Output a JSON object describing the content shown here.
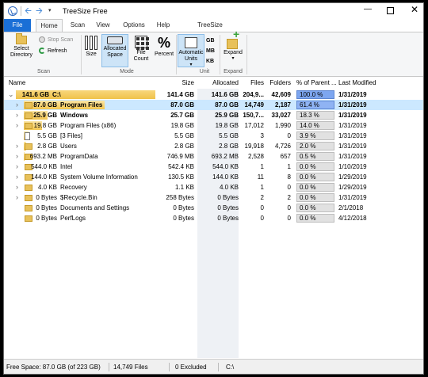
{
  "window": {
    "title": "TreeSize Free",
    "controls": {
      "minimize": "—",
      "close": "✕"
    },
    "nav": {
      "back": "🡨",
      "forward": "🡪",
      "dropdown": "▾"
    }
  },
  "tabs": [
    "File",
    "Home",
    "Scan",
    "View",
    "Options",
    "Help",
    "TreeSize Professional"
  ],
  "ribbon": {
    "scan_group": {
      "select_directory": "Select\nDirectory",
      "stop_scan": "Stop Scan",
      "refresh": "Refresh",
      "label": "Scan"
    },
    "mode_group": {
      "size": "Size",
      "allocated_space": "Allocated\nSpace",
      "file_count": "File\nCount",
      "percent": "Percent",
      "label": "Mode"
    },
    "unit_group": {
      "gb": "GB",
      "mb": "MB",
      "kb": "KB",
      "automatic_units": "Automatic\nUnits",
      "label": "Unit"
    },
    "expand_group": {
      "expand": "Expand",
      "label": "Expand"
    },
    "icons": {
      "percent_glyph": "%",
      "dropdown": "▾"
    }
  },
  "columns": {
    "name": "Name",
    "size": "Size",
    "allocated": "Allocated",
    "files": "Files",
    "folders": "Folders",
    "pct_parent": "% of Parent ...",
    "last_modified": "Last Modified"
  },
  "rows": [
    {
      "gbsize": "141.6 GB",
      "name": "C:\\",
      "size": "141.4 GB",
      "allocated": "141.6 GB",
      "files": "204,9...",
      "folders": "42,609",
      "pct": "100.0 %",
      "pct_value": 100.0,
      "modified": "1/31/2019",
      "bold": true,
      "chevron": "⌄"
    },
    {
      "gbsize": "87.0 GB",
      "name": "Program Files",
      "size": "87.0 GB",
      "allocated": "87.0 GB",
      "files": "14,749",
      "folders": "2,187",
      "pct": "61.4 %",
      "pct_value": 61.4,
      "modified": "1/31/2019",
      "bold": true,
      "chevron": "›"
    },
    {
      "gbsize": "25.9 GB",
      "name": "Windows",
      "size": "25.7 GB",
      "allocated": "25.9 GB",
      "files": "150,7...",
      "folders": "33,027",
      "pct": "18.3 %",
      "pct_value": 18.3,
      "modified": "1/31/2019",
      "bold": true,
      "chevron": "›"
    },
    {
      "gbsize": "19.8 GB",
      "name": "Program Files (x86)",
      "size": "19.8 GB",
      "allocated": "19.8 GB",
      "files": "17,012",
      "folders": "1,990",
      "pct": "14.0 %",
      "pct_value": 14.0,
      "modified": "1/31/2019",
      "bold": false,
      "chevron": "›"
    },
    {
      "gbsize": "5.5 GB",
      "name": "[3 Files]",
      "size": "5.5 GB",
      "allocated": "5.5 GB",
      "files": "3",
      "folders": "0",
      "pct": "3.9 %",
      "pct_value": 3.9,
      "modified": "1/31/2019",
      "bold": false,
      "chevron": ""
    },
    {
      "gbsize": "2.8 GB",
      "name": "Users",
      "size": "2.8 GB",
      "allocated": "2.8 GB",
      "files": "19,918",
      "folders": "4,726",
      "pct": "2.0 %",
      "pct_value": 2.0,
      "modified": "1/31/2019",
      "bold": false,
      "chevron": "›"
    },
    {
      "gbsize": "693.2 MB",
      "name": "ProgramData",
      "size": "746.9 MB",
      "allocated": "693.2 MB",
      "files": "2,528",
      "folders": "657",
      "pct": "0.5 %",
      "pct_value": 0.5,
      "modified": "1/31/2019",
      "bold": false,
      "chevron": "›"
    },
    {
      "gbsize": "544.0 KB",
      "name": "Intel",
      "size": "542.4 KB",
      "allocated": "544.0 KB",
      "files": "1",
      "folders": "1",
      "pct": "0.0 %",
      "pct_value": 0.0,
      "modified": "1/10/2019",
      "bold": false,
      "chevron": "›"
    },
    {
      "gbsize": "144.0 KB",
      "name": "System Volume Information",
      "size": "130.5 KB",
      "allocated": "144.0 KB",
      "files": "11",
      "folders": "8",
      "pct": "0.0 %",
      "pct_value": 0.0,
      "modified": "1/29/2019",
      "bold": false,
      "chevron": "›"
    },
    {
      "gbsize": "4.0 KB",
      "name": "Recovery",
      "size": "1.1 KB",
      "allocated": "4.0 KB",
      "files": "1",
      "folders": "0",
      "pct": "0.0 %",
      "pct_value": 0.0,
      "modified": "1/29/2019",
      "bold": false,
      "chevron": "›"
    },
    {
      "gbsize": "0 Bytes",
      "name": "$Recycle.Bin",
      "size": "258 Bytes",
      "allocated": "0 Bytes",
      "files": "2",
      "folders": "2",
      "pct": "0.0 %",
      "pct_value": 0.0,
      "modified": "1/31/2019",
      "bold": false,
      "chevron": "›"
    },
    {
      "gbsize": "0 Bytes",
      "name": "Documents and Settings",
      "size": "0 Bytes",
      "allocated": "0 Bytes",
      "files": "0",
      "folders": "0",
      "pct": "0.0 %",
      "pct_value": 0.0,
      "modified": "2/1/2018",
      "bold": false,
      "chevron": ""
    },
    {
      "gbsize": "0 Bytes",
      "name": "PerfLogs",
      "size": "0 Bytes",
      "allocated": "0 Bytes",
      "files": "0",
      "folders": "0",
      "pct": "0.0 %",
      "pct_value": 0.0,
      "modified": "4/12/2018",
      "bold": false,
      "chevron": ""
    }
  ],
  "status": {
    "free_space": "Free Space: 87.0 GB  (of 223 GB)",
    "files": "14,749  Files",
    "excluded": "0 Excluded",
    "path": "C:\\"
  },
  "colors": {
    "accent": "#1a6fd6",
    "selection": "#cce8ff",
    "root_highlight": "#f5d77a",
    "percent_highlight": "#7da6f0"
  }
}
